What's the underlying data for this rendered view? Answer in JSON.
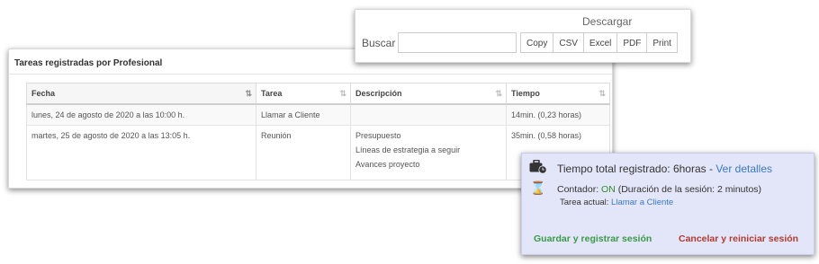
{
  "panel": {
    "title": "Tareas registradas por Profesional",
    "columns": [
      "Fecha",
      "Tarea",
      "Descripción",
      "Tiempo"
    ],
    "rows": [
      {
        "fecha": "lunes, 24 de agosto de 2020 a las 10:00 h.",
        "tarea": "Llamar a Cliente",
        "descripcion": [],
        "tiempo": "14min. (0,23 horas)"
      },
      {
        "fecha": "martes, 25 de agosto de 2020 a las 13:05 h.",
        "tarea": "Reunión",
        "descripcion": [
          "Presupuesto",
          "Líneas de estrategia a seguir",
          "Avances proyecto"
        ],
        "tiempo": "35min. (0,58 horas)"
      }
    ]
  },
  "toolbar": {
    "download_label": "Descargar",
    "search_label": "Buscar",
    "search_value": "",
    "buttons": [
      "Copy",
      "CSV",
      "Excel",
      "PDF",
      "Print"
    ]
  },
  "session": {
    "total_prefix": "Tiempo total registrado: 6horas - ",
    "details_link": "Ver detalles",
    "counter_prefix": "Contador: ",
    "counter_status": "ON",
    "counter_suffix": " (Duración de la sesión: 2 minutos)",
    "task_prefix": "Tarea actual: ",
    "task_link": "Llamar a Cliente",
    "save_button": "Guardar y registrar sesión",
    "cancel_button": "Cancelar y reiniciar sesión"
  },
  "colors": {
    "widget_bg": "#e3e6f8",
    "link": "#3a78c2",
    "on_status": "#2e8b2e",
    "save": "#3a9a4a",
    "cancel": "#b03a30"
  },
  "icons": {
    "sort_active": "sort-alpha-icon",
    "sort_inactive": "sort-both-icon",
    "briefcase": "briefcase-clock-icon",
    "hourglass": "hourglass-icon"
  }
}
